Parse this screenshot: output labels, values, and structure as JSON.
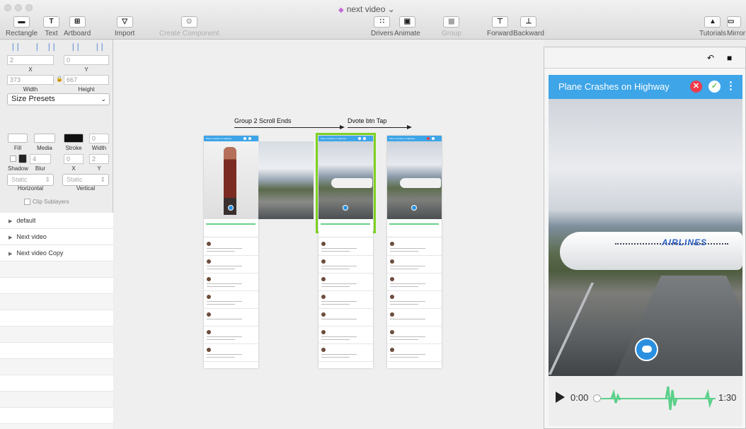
{
  "window": {
    "title": "next video",
    "title_chevron": "⌄"
  },
  "toolbar": {
    "rectangle": "Rectangle",
    "text": "Text",
    "artboard": "Artboard",
    "import": "Import",
    "create_component": "Create Component",
    "drivers": "Drivers",
    "animate": "Animate",
    "group": "Group",
    "forward": "Forward",
    "backward": "Backward",
    "tutorials": "Tutorials",
    "mirror": "Mirror"
  },
  "inspector": {
    "x_value": "2",
    "y_value": "0",
    "x_label": "X",
    "y_label": "Y",
    "width_value": "373",
    "height_value": "667",
    "width_label": "Width",
    "height_label": "Height",
    "size_presets": "Size Presets",
    "fill_label": "Fill",
    "media_label": "Media",
    "stroke_label": "Stroke",
    "stroke_width_label": "Width",
    "stroke_width_value": "0",
    "shadow_label": "Shadow",
    "blur_label": "Blur",
    "shadow_x_label": "X",
    "shadow_y_label": "Y",
    "blur_value": "4",
    "shadow_x_value": "0",
    "shadow_y_value": "2",
    "horizontal_value": "Static",
    "vertical_value": "Static",
    "horizontal_label": "Horizontal",
    "vertical_label": "Vertical",
    "clip_sublayers": "Clip Sublayers"
  },
  "layers": [
    "default",
    "Next video",
    "Next video Copy"
  ],
  "canvas": {
    "flow1_label": "Group 2 Scroll Ends",
    "flow2_label": "Dvote btn Tap",
    "board_title": "Plane Crashes on Highway"
  },
  "preview": {
    "title": "Plane Crashes on Highway",
    "airlines_text": "AIRLINES",
    "time_start": "0:00",
    "time_end": "1:30",
    "progress": 0,
    "colors": {
      "header": "#3ea5e8",
      "close": "#ee3b4a",
      "check": "#6ac259",
      "wave": "#5bd08a"
    }
  }
}
